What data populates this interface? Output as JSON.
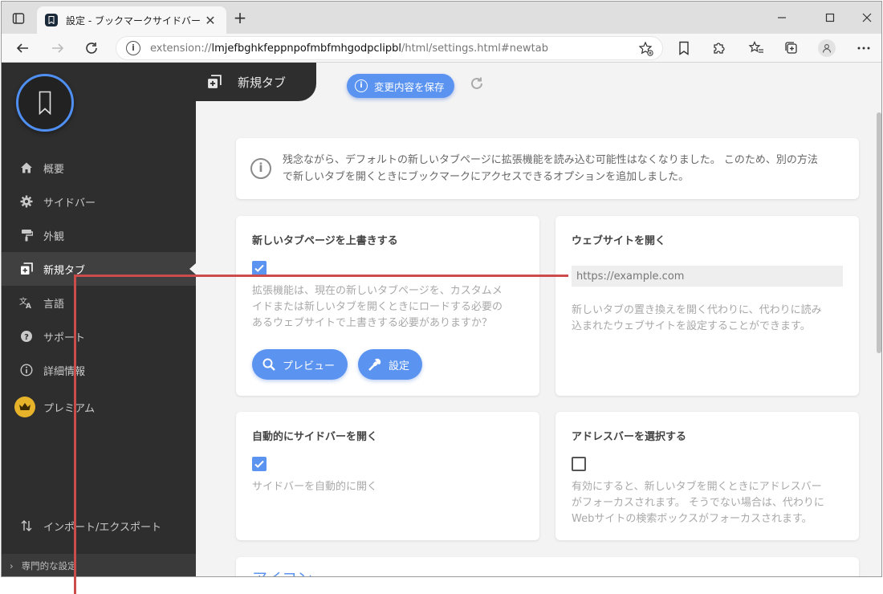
{
  "browser": {
    "tab_title": "設定 - ブックマークサイドバー",
    "url_scheme": "extension://",
    "url_host": "lmjefbghkfeppnpofmbfmhgodpclipbl",
    "url_path": "/html/settings.html#newtab"
  },
  "sidebar": {
    "items": [
      {
        "label": "概要",
        "icon": "home-icon"
      },
      {
        "label": "サイドバー",
        "icon": "gear-icon"
      },
      {
        "label": "外観",
        "icon": "paint-roller-icon"
      },
      {
        "label": "新規タブ",
        "icon": "new-tab-icon"
      },
      {
        "label": "言語",
        "icon": "translate-icon"
      },
      {
        "label": "サポート",
        "icon": "help-icon"
      },
      {
        "label": "詳細情報",
        "icon": "info-icon"
      },
      {
        "label": "プレミアム",
        "icon": "crown-icon"
      }
    ],
    "import_export": "インポート/エクスポート",
    "advanced": "専門的な設定"
  },
  "header": {
    "section_title": "新規タブ",
    "save_label": "変更内容を保存"
  },
  "notice": {
    "line1": "残念ながら、デフォルトの新しいタブページに拡張機能を読み込む可能性はなくなりました。 このため、別の方法",
    "line2": "で新しいタブを開くときにブックマークにアクセスできるオプションを追加しました。"
  },
  "cards": {
    "override": {
      "title": "新しいタブページを上書きする",
      "checked": true,
      "desc1": "拡張機能は、現在の新しいタブページを、カスタムメ",
      "desc2": "イドまたは新しいタブを開くときにロードする必要の",
      "desc3": "あるウェブサイトで上書きする必要がありますか？",
      "preview_label": "プレビュー",
      "settings_label": "設定"
    },
    "website": {
      "title": "ウェブサイトを開く",
      "placeholder": "https://example.com",
      "desc1": "新しいタブの置き換えを開く代わりに、代わりに読み",
      "desc2": "込まれたウェブサイトを設定することができます。"
    },
    "auto_sidebar": {
      "title": "自動的にサイドバーを開く",
      "checked": true,
      "desc1": "サイドバーを自動的に開く"
    },
    "addressbar": {
      "title": "アドレスバーを選択する",
      "checked": false,
      "desc1": "有効にすると、新しいタブを開くときにアドレスバー",
      "desc2": "がフォーカスされます。 そうでない場合は、代わりに",
      "desc3": "Webサイトの検索ボックスがフォーカスされます。"
    },
    "icons": {
      "title": "アイコン"
    }
  },
  "colors": {
    "accent": "#5b93f0",
    "sidebar_bg": "#2e2e2e",
    "annotation": "#cc4b4b"
  }
}
